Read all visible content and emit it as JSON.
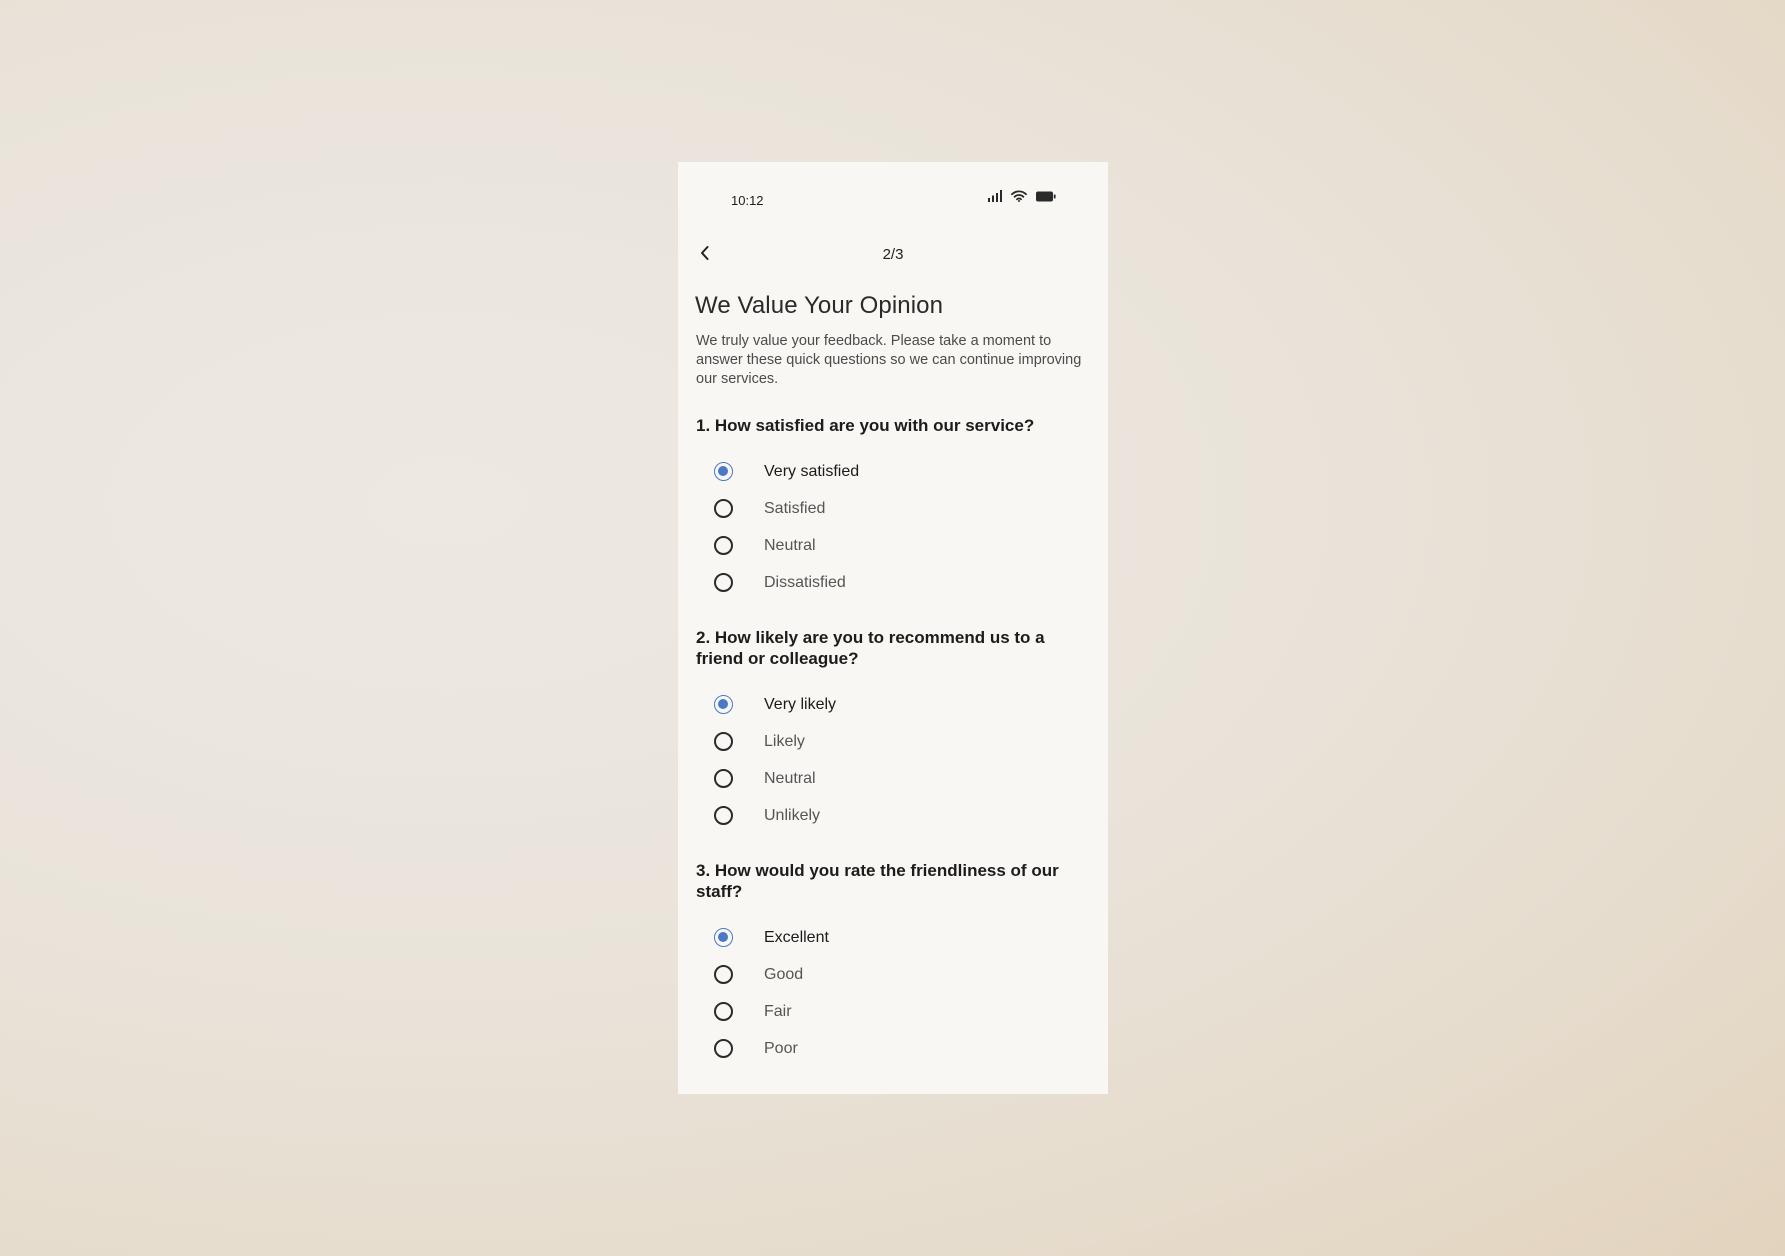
{
  "status_bar": {
    "time": "10:12",
    "icons": [
      "signal-icon",
      "wifi-icon",
      "battery-icon"
    ]
  },
  "nav": {
    "back_icon": "chevron-left-icon",
    "page_indicator": "2/3"
  },
  "title": "We Value Your Opinion",
  "intro": "We truly value your feedback. Please take a moment to answer these quick questions so we can continue improving our services.",
  "colors": {
    "accent": "#4a79c5",
    "screen_background": "#f8f7f3"
  },
  "questions": [
    {
      "text": "1. How satisfied are you with our service?",
      "selected_index": 0,
      "options": [
        "Very satisfied",
        "Satisfied",
        "Neutral",
        "Dissatisfied"
      ]
    },
    {
      "text": "2. How likely are you to recommend us to a friend or colleague?",
      "selected_index": 0,
      "options": [
        "Very likely",
        "Likely",
        "Neutral",
        "Unlikely"
      ]
    },
    {
      "text": "3. How would you rate the friendliness of our staff?",
      "selected_index": 0,
      "options": [
        "Excellent",
        "Good",
        "Fair",
        "Poor"
      ]
    }
  ]
}
